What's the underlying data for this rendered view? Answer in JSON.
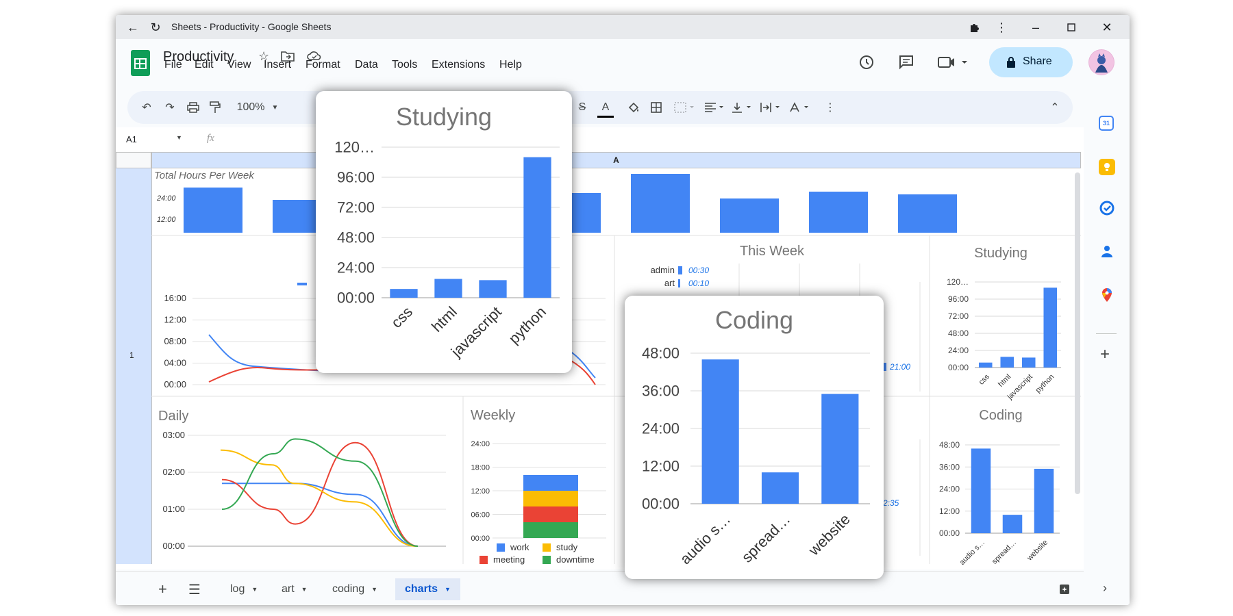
{
  "window": {
    "title": "Sheets - Productivity - Google Sheets",
    "controls": [
      "minimize",
      "maximize",
      "close"
    ]
  },
  "doc": {
    "title": "Productivity",
    "menu": [
      "File",
      "Edit",
      "View",
      "Insert",
      "Format",
      "Data",
      "Tools",
      "Extensions",
      "Help"
    ],
    "share_label": "Share"
  },
  "toolbar": {
    "zoom": "100%"
  },
  "formula_bar": {
    "cell_ref": "A1",
    "fx": "fx"
  },
  "grid": {
    "column_header": "A",
    "row_header": "1"
  },
  "sheet_tabs": [
    {
      "label": "log",
      "active": false
    },
    {
      "label": "art",
      "active": false
    },
    {
      "label": "coding",
      "active": false
    },
    {
      "label": "charts",
      "active": true
    }
  ],
  "colors": {
    "blue": "#4285f4",
    "red": "#ea4335",
    "yellow": "#fbbc04",
    "green": "#34a853",
    "accent": "#0b57d0",
    "share_bg": "#c2e7ff",
    "col_header": "#d3e3fd"
  },
  "charts": {
    "total_hours": {
      "title": "Total Hours Per Week",
      "y_ticks": [
        "24:00",
        "12:00"
      ]
    },
    "trend": {
      "y_ticks": [
        "16:00",
        "12:00",
        "08:00",
        "04:00",
        "00:00"
      ]
    },
    "daily": {
      "title": "Daily",
      "y_ticks": [
        "03:00",
        "02:00",
        "01:00",
        "00:00"
      ]
    },
    "weekly": {
      "title": "Weekly",
      "y_ticks": [
        "24:00",
        "18:00",
        "12:00",
        "06:00",
        "00:00"
      ],
      "legend": [
        "work",
        "study",
        "meeting",
        "downtime"
      ]
    },
    "this_week": {
      "title": "This Week",
      "rows": [
        {
          "label": "admin",
          "value": "00:30"
        },
        {
          "label": "art",
          "value": "00:10"
        }
      ],
      "partial_values": [
        "21:00",
        "2:35"
      ]
    },
    "studying_small": {
      "title": "Studying",
      "y_ticks": [
        "120…",
        "96:00",
        "72:00",
        "48:00",
        "24:00",
        "00:00"
      ],
      "categories": [
        "css",
        "html",
        "javascript",
        "python"
      ]
    },
    "coding_small": {
      "title": "Coding",
      "y_ticks": [
        "48:00",
        "36:00",
        "24:00",
        "12:00",
        "00:00"
      ],
      "categories": [
        "audio s…",
        "spread…",
        "website"
      ]
    },
    "studying_popup": {
      "title": "Studying",
      "y_ticks": [
        "120…",
        "96:00",
        "72:00",
        "48:00",
        "24:00",
        "00:00"
      ],
      "categories": [
        "css",
        "html",
        "javascript",
        "python"
      ]
    },
    "coding_popup": {
      "title": "Coding",
      "y_ticks": [
        "48:00",
        "36:00",
        "24:00",
        "12:00",
        "00:00"
      ],
      "categories": [
        "audio s…",
        "spread…",
        "website"
      ]
    }
  },
  "chart_data": [
    {
      "type": "bar",
      "title": "Studying",
      "categories": [
        "css",
        "html",
        "javascript",
        "python"
      ],
      "values": [
        7,
        15,
        14,
        112
      ],
      "units": "hours",
      "ylim": [
        0,
        120
      ]
    },
    {
      "type": "bar",
      "title": "Coding",
      "categories": [
        "audio s…",
        "spread…",
        "website"
      ],
      "values": [
        46,
        10,
        35
      ],
      "units": "hours",
      "ylim": [
        0,
        48
      ]
    },
    {
      "type": "bar",
      "title": "Weekly",
      "categories": [
        ""
      ],
      "series": [
        {
          "name": "work",
          "values": [
            4
          ]
        },
        {
          "name": "study",
          "values": [
            4
          ]
        },
        {
          "name": "meeting",
          "values": [
            4
          ]
        },
        {
          "name": "downtime",
          "values": [
            4
          ]
        }
      ],
      "units": "hours",
      "ylim": [
        0,
        24
      ]
    },
    {
      "type": "bar",
      "title": "Total Hours Per Week",
      "values": [
        33,
        24,
        30,
        28,
        29,
        43,
        25,
        30,
        28
      ],
      "units": "hours"
    },
    {
      "type": "line",
      "title": "Daily",
      "x": [
        0,
        1,
        2,
        3,
        4
      ],
      "series": [
        {
          "values": [
            1.7,
            1.7,
            1.7,
            1.4,
            0
          ]
        },
        {
          "values": [
            1.8,
            1.0,
            0.6,
            2.8,
            0
          ]
        },
        {
          "values": [
            2.6,
            2.2,
            1.7,
            1.2,
            0
          ]
        },
        {
          "values": [
            1.0,
            2.5,
            2.9,
            2.3,
            0
          ]
        }
      ],
      "units": "hours",
      "ylim": [
        0,
        3
      ]
    }
  ]
}
